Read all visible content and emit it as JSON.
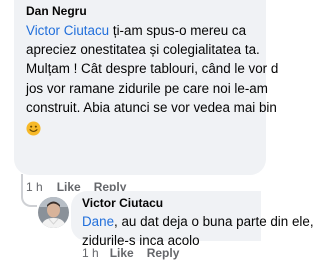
{
  "comment": {
    "author": "Dan Negru",
    "mention": "Victor Ciutacu",
    "line1_rest": " ți-am spus-o mereu ca",
    "line2": "apreciez onestitatea și colegialitatea ta.",
    "line3": "Mulțam ! Cât despre tablouri, când le vor d",
    "line4": "jos vor ramane zidurile pe care noi le-am",
    "line5": "construit. Abia atunci se vor vedea mai bin",
    "emoji": "smile-emoji",
    "time": "1 h",
    "like_label": "Like",
    "reply_label": "Reply"
  },
  "reply": {
    "author": "Victor Ciutacu",
    "mention": "Dane",
    "line1_rest": ", au dat deja o buna parte din ele,",
    "line2": "zidurile-s inca acolo",
    "time": "1 h",
    "like_label": "Like",
    "reply_label": "Reply"
  },
  "colors": {
    "bubble": "#f0f2f5",
    "mention": "#216fdb",
    "meta": "#65676b",
    "text": "#050505"
  }
}
